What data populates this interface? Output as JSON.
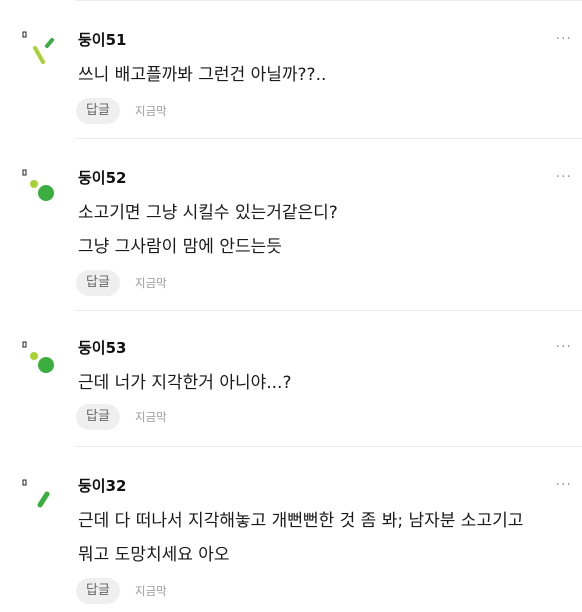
{
  "colors": {
    "accent_green": "#3aae3f",
    "accent_lime": "#a7d234",
    "nick_color": "#111111",
    "meta_color": "#9a9a9a",
    "reply_bg": "#efefef"
  },
  "comments": [
    {
      "nickname": "둥이51",
      "lines": [
        "쓰니 배고플까봐 그런건 아닐까??.."
      ],
      "reply_label": "답글",
      "time": "지금막",
      "more": "···",
      "avatar_icon": "sprout-slash-icon"
    },
    {
      "nickname": "둥이52",
      "lines": [
        "소고기면 그냥 시킬수 있는거같은디?",
        "그냥 그사람이 맘에 안드는듯"
      ],
      "reply_label": "답글",
      "time": "지금막",
      "more": "···",
      "avatar_icon": "green-dots-icon"
    },
    {
      "nickname": "둥이53",
      "lines": [
        "근데 너가 지각한거 아니야...?"
      ],
      "reply_label": "답글",
      "time": "지금막",
      "more": "···",
      "avatar_icon": "green-dots-icon"
    },
    {
      "nickname": "둥이32",
      "lines": [
        "근데 다 떠나서 지각해놓고 개뻔뻔한 것 좀 봐; 남자분 소고기고",
        "뭐고 도망치세요 아오"
      ],
      "reply_label": "답글",
      "time": "지금막",
      "more": "···",
      "avatar_icon": "green-slash-icon"
    }
  ]
}
